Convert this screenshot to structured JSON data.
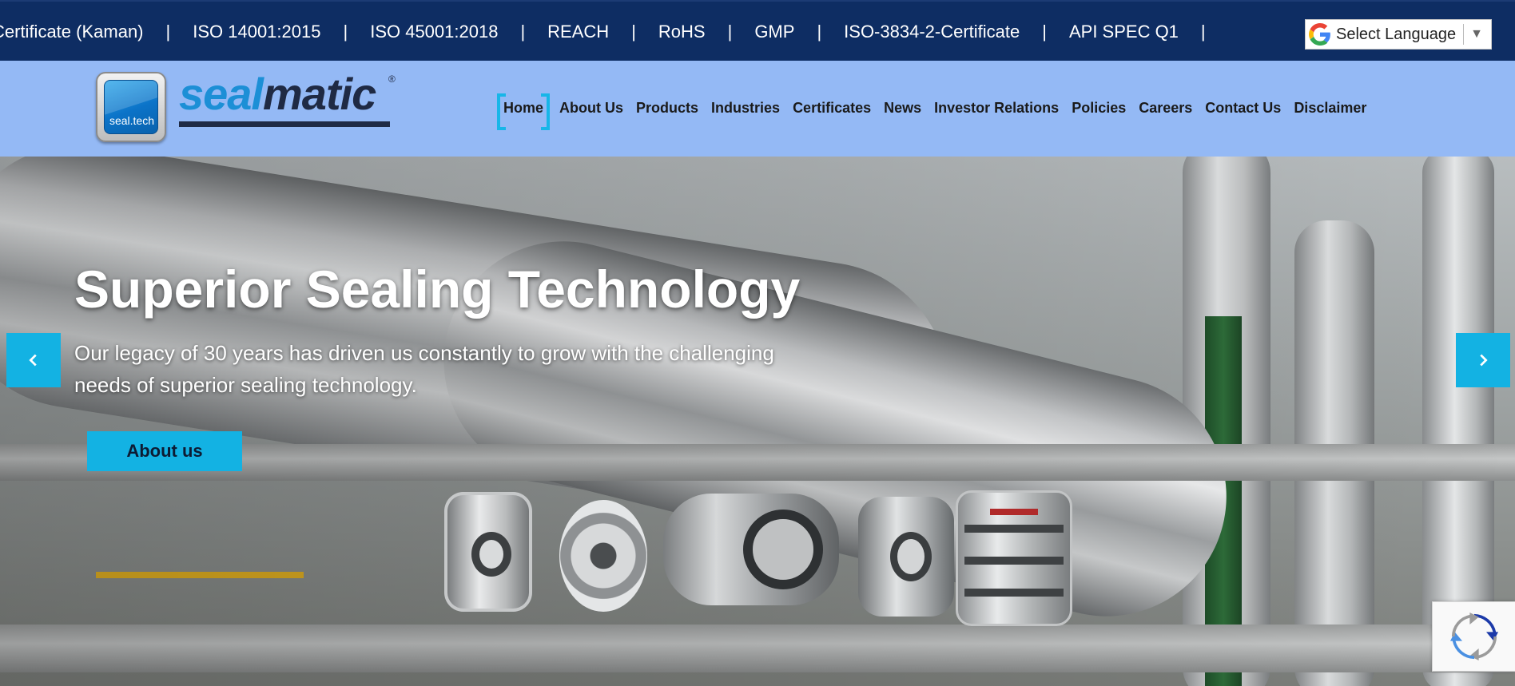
{
  "topbar": {
    "certificates": [
      "Certificate (Kaman)",
      "ISO 14001:2015",
      "ISO 45001:2018",
      "REACH",
      "RoHS",
      "GMP",
      "ISO-3834-2-Certificate",
      "API SPEC Q1"
    ],
    "separator": "|",
    "language_select": {
      "label": "Select Language",
      "icon": "google-icon",
      "caret": "▼"
    }
  },
  "header": {
    "logo": {
      "badge_text": "seal.tech",
      "word_part1": "seal",
      "word_part2": "matic",
      "reg_mark": "®"
    },
    "nav": [
      {
        "label": "Home",
        "active": true
      },
      {
        "label": "About Us",
        "active": false
      },
      {
        "label": "Products",
        "active": false
      },
      {
        "label": "Industries",
        "active": false
      },
      {
        "label": "Certificates",
        "active": false
      },
      {
        "label": "News",
        "active": false
      },
      {
        "label": "Investor Relations",
        "active": false
      },
      {
        "label": "Policies",
        "active": false
      },
      {
        "label": "Careers",
        "active": false
      },
      {
        "label": "Contact Us",
        "active": false
      },
      {
        "label": "Disclaimer",
        "active": false
      }
    ]
  },
  "hero": {
    "title": "Superior Sealing Technology",
    "subtitle": "Our legacy of 30 years has driven us constantly to grow with the challenging needs of superior sealing technology.",
    "cta_label": "About us",
    "prev_icon": "chevron-left-icon",
    "next_icon": "chevron-right-icon"
  },
  "recaptcha": {
    "icon": "recaptcha-icon"
  },
  "colors": {
    "topbar_bg": "#0e2d63",
    "header_bg": "#94b9f5",
    "accent": "#13b2e3",
    "active_bracket": "#17b6e8",
    "logo_blue": "#1c8fd6",
    "logo_dark": "#1f2a44"
  }
}
